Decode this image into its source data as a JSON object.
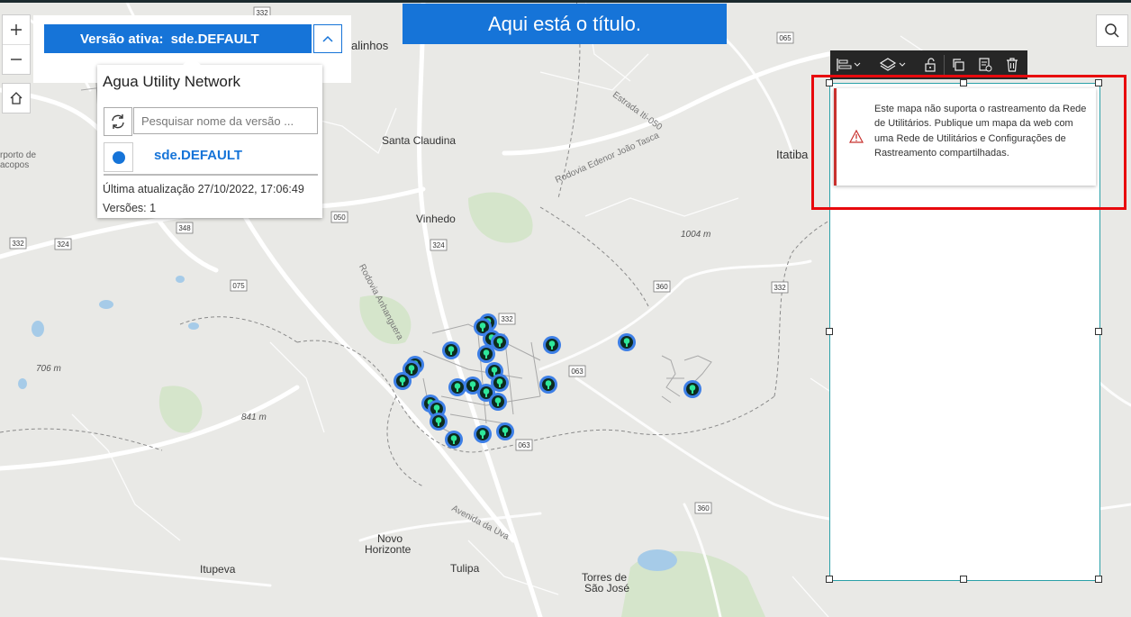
{
  "title": "Aqui está o título.",
  "version_widget": {
    "active_label": "Versão ativa:",
    "active_value": "sde.DEFAULT",
    "panel_title": "Agua Utility Network",
    "search_placeholder": "Pesquisar nome da versão ...",
    "version_item": "sde.DEFAULT",
    "last_update": "Última atualização 27/10/2022, 17:06:49",
    "count": "Versões: 1"
  },
  "alert": {
    "message": "Este mapa não suporta o rastreamento da Rede de Utilitários. Publique um mapa da web com uma Rede de Utilitários e Configurações de Rastreamento compartilhadas."
  },
  "map": {
    "places": [
      "Santa Claudina",
      "Vinhedo",
      "Itatiba",
      "alinhos",
      "Novo",
      "Horizonte",
      "Itupeva",
      "Tulipa",
      "Torres de",
      "São José",
      "rporto de",
      "acopos"
    ],
    "roads": [
      "Estrada Iti-050",
      "Rodovia Edenor João Tasca",
      "Rodovia Anhanguera",
      "Avenida da Uva"
    ],
    "shields": [
      "332",
      "065",
      "050",
      "348",
      "324",
      "075",
      "324",
      "332",
      "063",
      "360",
      "332",
      "063",
      "360",
      "332"
    ],
    "elevations": [
      "1004 m",
      "706 m",
      "841 m"
    ]
  },
  "colors": {
    "accent": "#1674d8",
    "alert": "#e8090d",
    "toolbar": "#262626"
  }
}
